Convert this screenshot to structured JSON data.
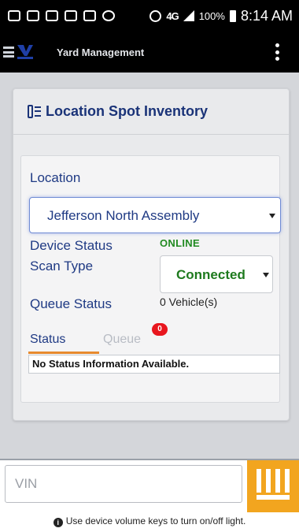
{
  "statusbar": {
    "network": "4G",
    "battery": "100%",
    "time": "8:14 AM"
  },
  "header": {
    "title": "Yard Management"
  },
  "panel": {
    "title": "Location Spot Inventory"
  },
  "form": {
    "location_label": "Location",
    "location_value": "Jefferson North Assembly",
    "device_status_label": "Device Status",
    "device_status_value": "ONLINE",
    "scan_type_label": "Scan Type",
    "scan_type_value": "Connected",
    "queue_status_label": "Queue Status",
    "queue_status_value": "0 Vehicle(s)"
  },
  "tabs": [
    {
      "label": "Status",
      "active": true
    },
    {
      "label": "Queue",
      "active": false,
      "badge": "0"
    }
  ],
  "status_message": "No Status Information Available.",
  "bottom": {
    "vin_placeholder": "VIN",
    "hint": "Use device volume keys to turn on/off light."
  },
  "colors": {
    "accent": "#1a3378",
    "online": "#228b22",
    "tab_underline": "#e78a2e",
    "scan_button": "#f2a51f",
    "badge": "#e8161e"
  },
  "icons": [
    "hamburger-icon",
    "logo-icon",
    "more-vert-icon",
    "inventory-icon",
    "chevron-down-icon",
    "barcode-icon",
    "info-icon"
  ]
}
